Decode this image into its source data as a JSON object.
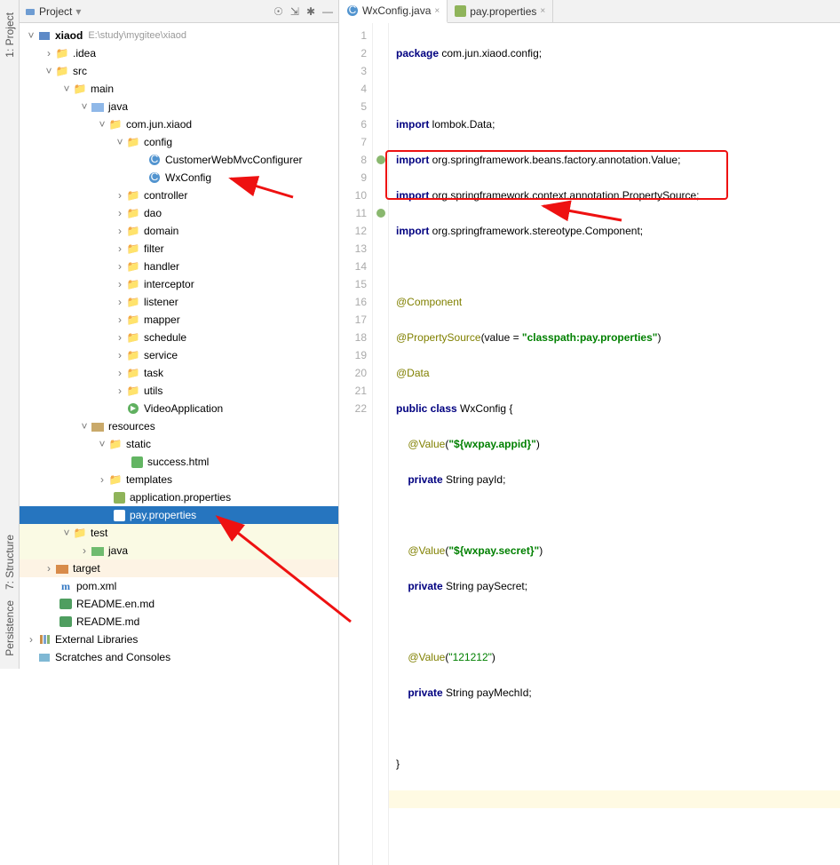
{
  "sidebar": {
    "top": "1: Project",
    "struct": "7: Structure",
    "pers": "Persistence"
  },
  "project": {
    "title": "Project",
    "root": "xiaod",
    "rootHint": "E:\\study\\mygitee\\xiaod",
    "idea": ".idea",
    "src": "src",
    "main": "main",
    "java": "java",
    "pkg": "com.jun.xiaod",
    "config": "config",
    "customer": "CustomerWebMvcConfigurer",
    "wxconfig": "WxConfig",
    "controller": "controller",
    "dao": "dao",
    "domain": "domain",
    "filter": "filter",
    "handler": "handler",
    "interceptor": "interceptor",
    "listener": "listener",
    "mapper": "mapper",
    "schedule": "schedule",
    "service": "service",
    "task": "task",
    "utils": "utils",
    "videoapp": "VideoApplication",
    "resources": "resources",
    "static": "static",
    "success": "success.html",
    "templates": "templates",
    "appprops": "application.properties",
    "payprops": "pay.properties",
    "test": "test",
    "testjava": "java",
    "target": "target",
    "pom": "pom.xml",
    "readmeen": "README.en.md",
    "readme": "README.md",
    "extlib": "External Libraries",
    "scratch": "Scratches and Consoles"
  },
  "tabs": {
    "t1": "WxConfig.java",
    "t2": "pay.properties"
  },
  "code": {
    "l1a": "package",
    "l1b": " com.jun.xiaod.config;",
    "l3a": "import",
    "l3b": " lombok.",
    "l3c": "Data",
    "l3d": ";",
    "l4a": "import",
    "l4b": " org.springframework.beans.factory.annotation.",
    "l4c": "Value",
    "l4d": ";",
    "l5a": "import",
    "l5b": " org.springframework.context.annotation.",
    "l5c": "PropertySource",
    "l5d": ";",
    "l6a": "import",
    "l6b": " org.springframework.stereotype.",
    "l6c": "Component",
    "l6d": ";",
    "l8": "@Component",
    "l9a": "@PropertySource",
    "l9b": "(value = ",
    "l9c": "\"classpath:pay.properties\"",
    "l9d": ")",
    "l10": "@Data",
    "l11a": "public class ",
    "l11b": "WxConfig ",
    "l11c": "{",
    "l12a": "    @Value",
    "l12b": "(",
    "l12c": "\"${wxpay.appid}\"",
    "l12d": ")",
    "l13a": "    ",
    "l13b": "private",
    "l13c": " String payId;",
    "l15a": "    @Value",
    "l15b": "(",
    "l15c": "\"${wxpay.secret}\"",
    "l15d": ")",
    "l16a": "    ",
    "l16b": "private",
    "l16c": " String paySecret;",
    "l18a": "    @Value",
    "l18b": "(",
    "l18c": "\"121212\"",
    "l18d": ")",
    "l19a": "    ",
    "l19b": "private",
    "l19c": " String payMechId;",
    "l21": "}"
  },
  "lines": [
    "1",
    "2",
    "3",
    "4",
    "5",
    "6",
    "7",
    "8",
    "9",
    "10",
    "11",
    "12",
    "13",
    "14",
    "15",
    "16",
    "17",
    "18",
    "19",
    "20",
    "21",
    "22"
  ]
}
